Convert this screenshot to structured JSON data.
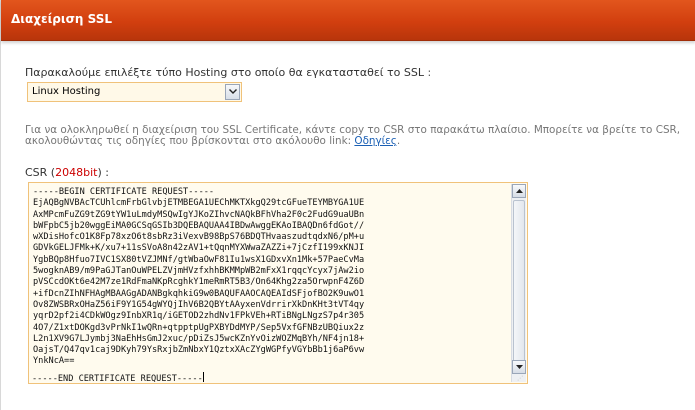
{
  "header": {
    "title": "Διαχείριση SSL"
  },
  "hosting": {
    "label": "Παρακαλούμε επιλέξτε τύπο Hosting στο οποίο θα εγκατασταθεί το SSL",
    "label_suffix": " :",
    "selected": "Linux Hosting"
  },
  "info": {
    "text": "Για να ολοκληρωθεί η διαχείριση του SSL Certificate, κάντε copy το CSR στο παρακάτω πλαίσιο. Μπορείτε να βρείτε το CSR, ακολουθώντας τις οδηγίες που βρίσκονται στο ακόλουθο link: ",
    "link_label": "Οδηγίες",
    "suffix": "."
  },
  "csr": {
    "label": "CSR",
    "bits": "2048bit",
    "bits_open": " (",
    "bits_close": ") :",
    "content": "-----BEGIN CERTIFICATE REQUEST-----\nEjAQBgNVBAcTCUhlcmFrbGlvbjETMBEGA1UEChMKTXkgQ29tcGFueTEYMBYGA1UE\nAxMPcmFuZG9tZG9tYW1uLmdyMSQwIgYJKoZIhvcNAQkBFhVha2F0c2FudG9uaUBn\nbWFpbC5jb20wggEiMA0GCSqGSIb3DQEBAQUAA4IBDwAwggEKAoIBAQDn6fdGot//\nwXDisHofcO1K8Fp78xzO6t8sbRz3iVexvB98BpS76BDQTHvaaszudtqdxN6/pM+u\nGDVkGELJFMk+K/xu7+11sSVoA8n42zAV1+tQqnMYXWwaZAZZi+7jCzfI199xKNJI\nYgbBQp8Hfuo7IVC1SX80tVZJMNf/gtWbaOwF81Iu1wsX1GDxvXn1Mk+57PaeCvMa\n5wogknAB9/m9PaGJTanOuWPELZVjmHVzfxhhBKMMpWB2mFxX1rqqcYcyx7jAw2io\npVSCcdOKt6e42M7ze1RdFmaNKpRcghkY1meRmRT5B3/On64Khg2za5OrwpnF4Z6D\n+ifDcnZIhNFHAgMBAAGgADANBgkqhkiG9w0BAQUFAAOCAQEAIdSFjofBO2K9uwO1\nOv8ZWSBRxOHaZ56iF9Y1G54gWYQjIhV6B2QBYtAAyxenVdrrirXkDnKHt3tVT4qy\nyqrD2pf2i4CDkWOgz9InbXR1q/iGETOD2zhdNv1FPkVEh+RTiBNgLNgzS7p4r305\n4O7/Z1xtDOKgd3vPrNkI1wQRn+qtpptpUgPXBYDdMYP/Sep5VxfGFNBzUBQiux2z\nL2n1XV9G7LJymbj3NaEhHsGmJ2xuc/pDiZsJ5wcKZnYvOizWOZMqBYh/NF4jn18+\nOajsT/Q47qv1caj9DKyh79YsRxjbZmNbxY1QztxXAcZYgWGPfyVGYbBb1j6aP6vw\nYnkNcA==",
    "footer": "-----END CERTIFICATE REQUEST-----"
  }
}
